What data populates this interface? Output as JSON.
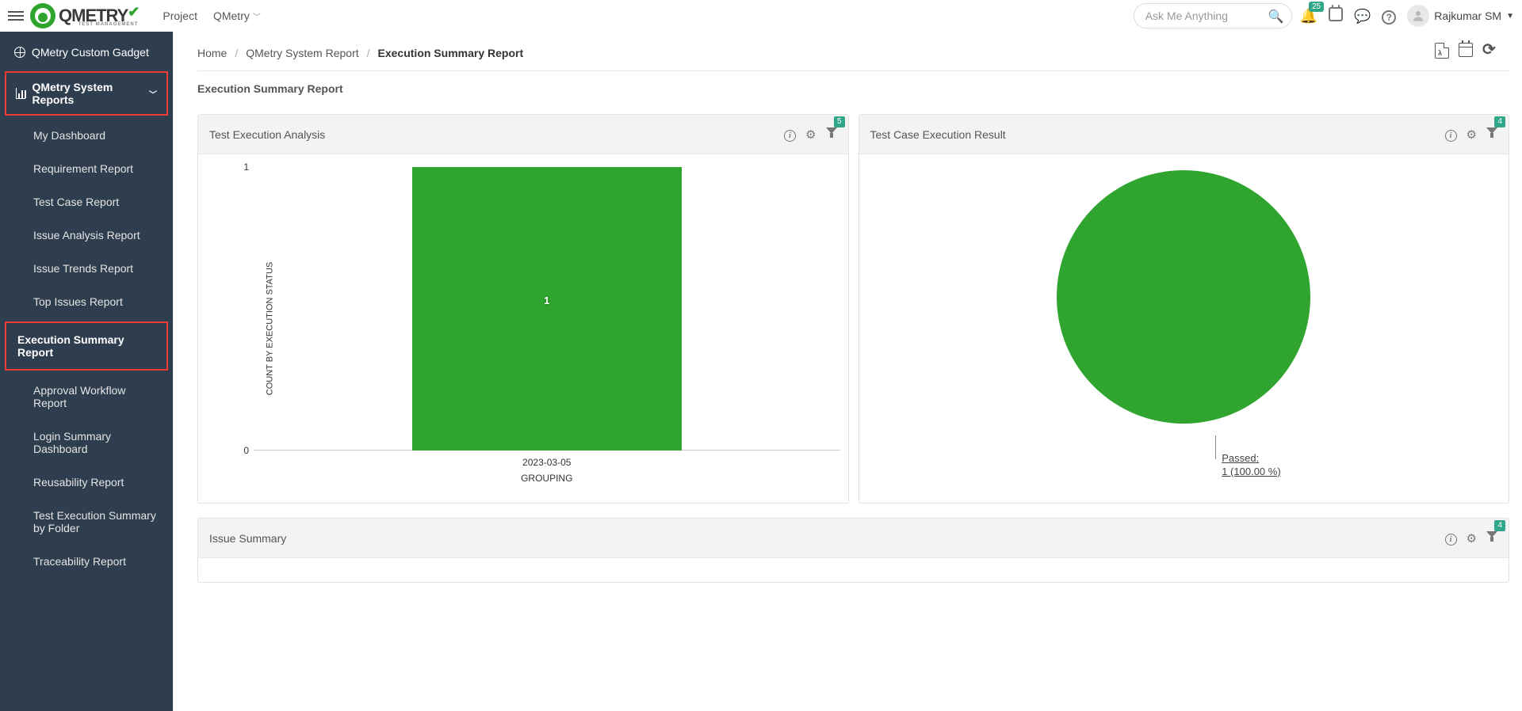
{
  "top": {
    "logo_text": "QMETRY",
    "logo_sub": "TEST MANAGEMENT",
    "project": "Project",
    "qmetry": "QMetry",
    "search_ph": "Ask Me Anything",
    "notif_badge": "25",
    "user": "Rajkumar SM"
  },
  "sidebar": {
    "custom_gadget": "QMetry Custom Gadget",
    "system_reports": "QMetry System Reports",
    "items": [
      "My Dashboard",
      "Requirement Report",
      "Test Case Report",
      "Issue Analysis Report",
      "Issue Trends Report",
      "Top Issues Report",
      "Execution Summary Report",
      "Approval Workflow Report",
      "Login Summary Dashboard",
      "Reusability Report",
      "Test Execution Summary by Folder",
      "Traceability Report"
    ]
  },
  "breadcrumb": {
    "home": "Home",
    "sys": "QMetry System Report",
    "cur": "Execution Summary Report"
  },
  "page_title": "Execution Summary Report",
  "cards": {
    "analysis": {
      "title": "Test Execution Analysis",
      "filter_count": "5",
      "ylabel": "COUNT BY EXECUTION STATUS",
      "xlabel": "GROUPING",
      "category": "2023-03-05",
      "value_label": "1",
      "y_tick_top": "1",
      "y_tick_bottom": "0"
    },
    "result": {
      "title": "Test Case Execution Result",
      "filter_count": "4",
      "slice_label_line1": "Passed:",
      "slice_label_line2": "1 (100.00 %)"
    },
    "issue": {
      "title": "Issue Summary",
      "filter_count": "4"
    }
  },
  "chart_data": [
    {
      "type": "bar",
      "title": "Test Execution Analysis",
      "xlabel": "GROUPING",
      "ylabel": "COUNT BY EXECUTION STATUS",
      "categories": [
        "2023-03-05"
      ],
      "series": [
        {
          "name": "Passed",
          "color": "#2fa52f",
          "values": [
            1
          ]
        }
      ],
      "ylim": [
        0,
        1
      ]
    },
    {
      "type": "pie",
      "title": "Test Case Execution Result",
      "slices": [
        {
          "name": "Passed",
          "value": 1,
          "percent": 100.0,
          "color": "#2fa52f"
        }
      ]
    }
  ]
}
